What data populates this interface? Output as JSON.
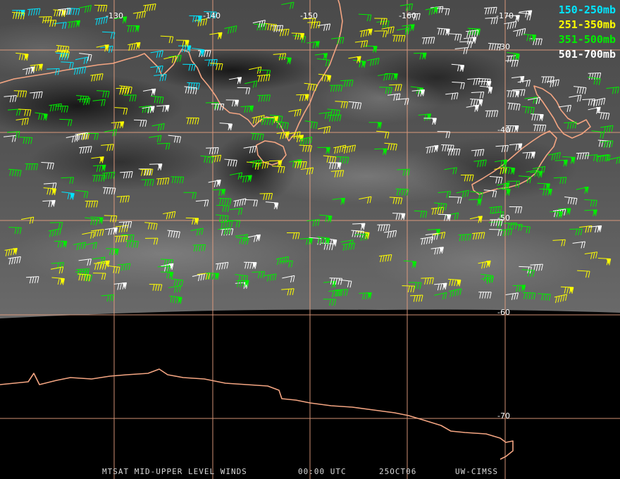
{
  "title": "MTSAT MID-UPPER LEVEL WINDS",
  "time": "00:00 UTC",
  "date": "25OCT06",
  "credit": "UW-CIMSS",
  "legend": [
    {
      "label": "150-250mb",
      "color": "#00e5ff"
    },
    {
      "label": "251-350mb",
      "color": "#ffff00"
    },
    {
      "label": "351-500mb",
      "color": "#00ee00"
    },
    {
      "label": "501-700mb",
      "color": "#ffffff"
    }
  ],
  "longitude_labels": [
    "-130",
    "-140",
    "-150",
    "-160",
    "-170"
  ],
  "latitude_labels": [
    "-30",
    "-40",
    "-50",
    "-60",
    "-70"
  ],
  "colors": {
    "coastline": "#f4a582",
    "graticule": "#e8a080",
    "space": "#000000"
  }
}
